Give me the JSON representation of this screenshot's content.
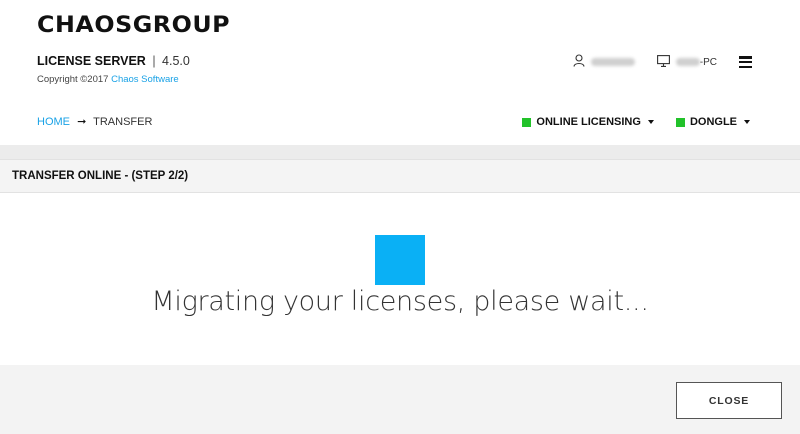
{
  "brand": {
    "logo_text": "CHAOSGROUP"
  },
  "app": {
    "name": "LICENSE SERVER",
    "separator": "|",
    "version": "4.5.0"
  },
  "copyright": {
    "prefix": "Copyright ©2017",
    "company": "Chaos Software"
  },
  "user": {
    "username": "",
    "pc_suffix": "-PC"
  },
  "breadcrumb": {
    "home": "HOME",
    "arrow": "➞",
    "current": "TRANSFER"
  },
  "status": [
    {
      "label": "ONLINE LICENSING",
      "color": "#22c22a"
    },
    {
      "label": "DONGLE",
      "color": "#22c22a"
    }
  ],
  "section": {
    "title": "TRANSFER ONLINE - (STEP 2/2)"
  },
  "progress": {
    "message": "Migrating your licenses, please wait...",
    "spinner_color": "#0ab0f5"
  },
  "footer": {
    "close_label": "CLOSE"
  },
  "icons": {
    "user": "user-icon",
    "computer": "monitor-icon",
    "menu": "hamburger-menu-icon"
  }
}
